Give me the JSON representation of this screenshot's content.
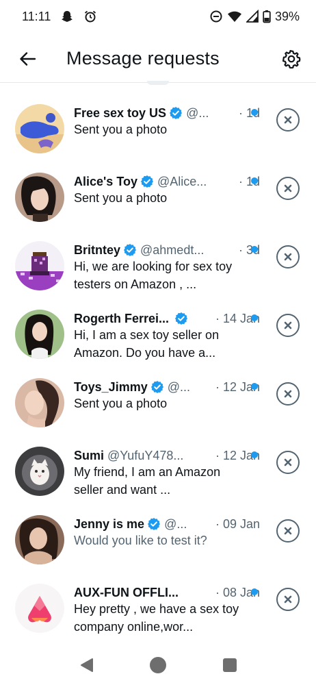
{
  "status_bar": {
    "time": "11:11",
    "battery": "39%",
    "icons": [
      "snapchat-ghost-icon",
      "alarm-icon",
      "do-not-disturb-icon",
      "wifi-icon",
      "cell-signal-icon",
      "battery-icon"
    ]
  },
  "header": {
    "title": "Message requests",
    "back_icon": "back-arrow-icon",
    "settings_icon": "gear-icon"
  },
  "colors": {
    "accent": "#1d9bf0",
    "text": "#0f1419",
    "secondary": "#536471"
  },
  "requests": [
    {
      "name": "Free sex toy US",
      "verified": true,
      "handle": "@...",
      "time": "· 1d",
      "unread": true,
      "preview": "Sent you a photo",
      "preview_read": false
    },
    {
      "name": "Alice's Toy",
      "verified": true,
      "handle": "@Alice...",
      "time": "· 1d",
      "unread": true,
      "preview": "Sent you a photo",
      "preview_read": false
    },
    {
      "name": "Britntey",
      "verified": true,
      "handle": "@ahmedt...",
      "time": "· 3d",
      "unread": true,
      "preview": "Hi, we are looking for sex toy testers on Amazon , ...",
      "preview_read": false
    },
    {
      "name": "Rogerth Ferrei...",
      "verified": true,
      "handle": "",
      "time": "· 14 Jan",
      "unread": true,
      "preview": "Hi, I am a sex toy seller on Amazon. Do you have a...",
      "preview_read": false
    },
    {
      "name": "Toys_Jimmy",
      "verified": true,
      "handle": "@...",
      "time": "· 12 Jan",
      "unread": true,
      "preview": "Sent you a photo",
      "preview_read": false
    },
    {
      "name": "Sumi",
      "verified": false,
      "handle": "@YufuY478...",
      "time": "· 12 Jan",
      "unread": true,
      "preview": "My friend, I am an Amazon seller and want ...",
      "preview_read": false
    },
    {
      "name": "Jenny is me",
      "verified": true,
      "handle": "@...",
      "time": "· 09 Jan",
      "unread": false,
      "preview": "Would you like to test it?",
      "preview_read": true
    },
    {
      "name": "AUX-FUN OFFLI...",
      "verified": false,
      "handle": "",
      "time": "· 08 Jan",
      "unread": true,
      "preview": "Hey pretty , we have a sex toy company online,wor...",
      "preview_read": false
    }
  ],
  "nav": {
    "back": "nav-back-icon",
    "home": "nav-home-icon",
    "recents": "nav-recents-icon"
  }
}
